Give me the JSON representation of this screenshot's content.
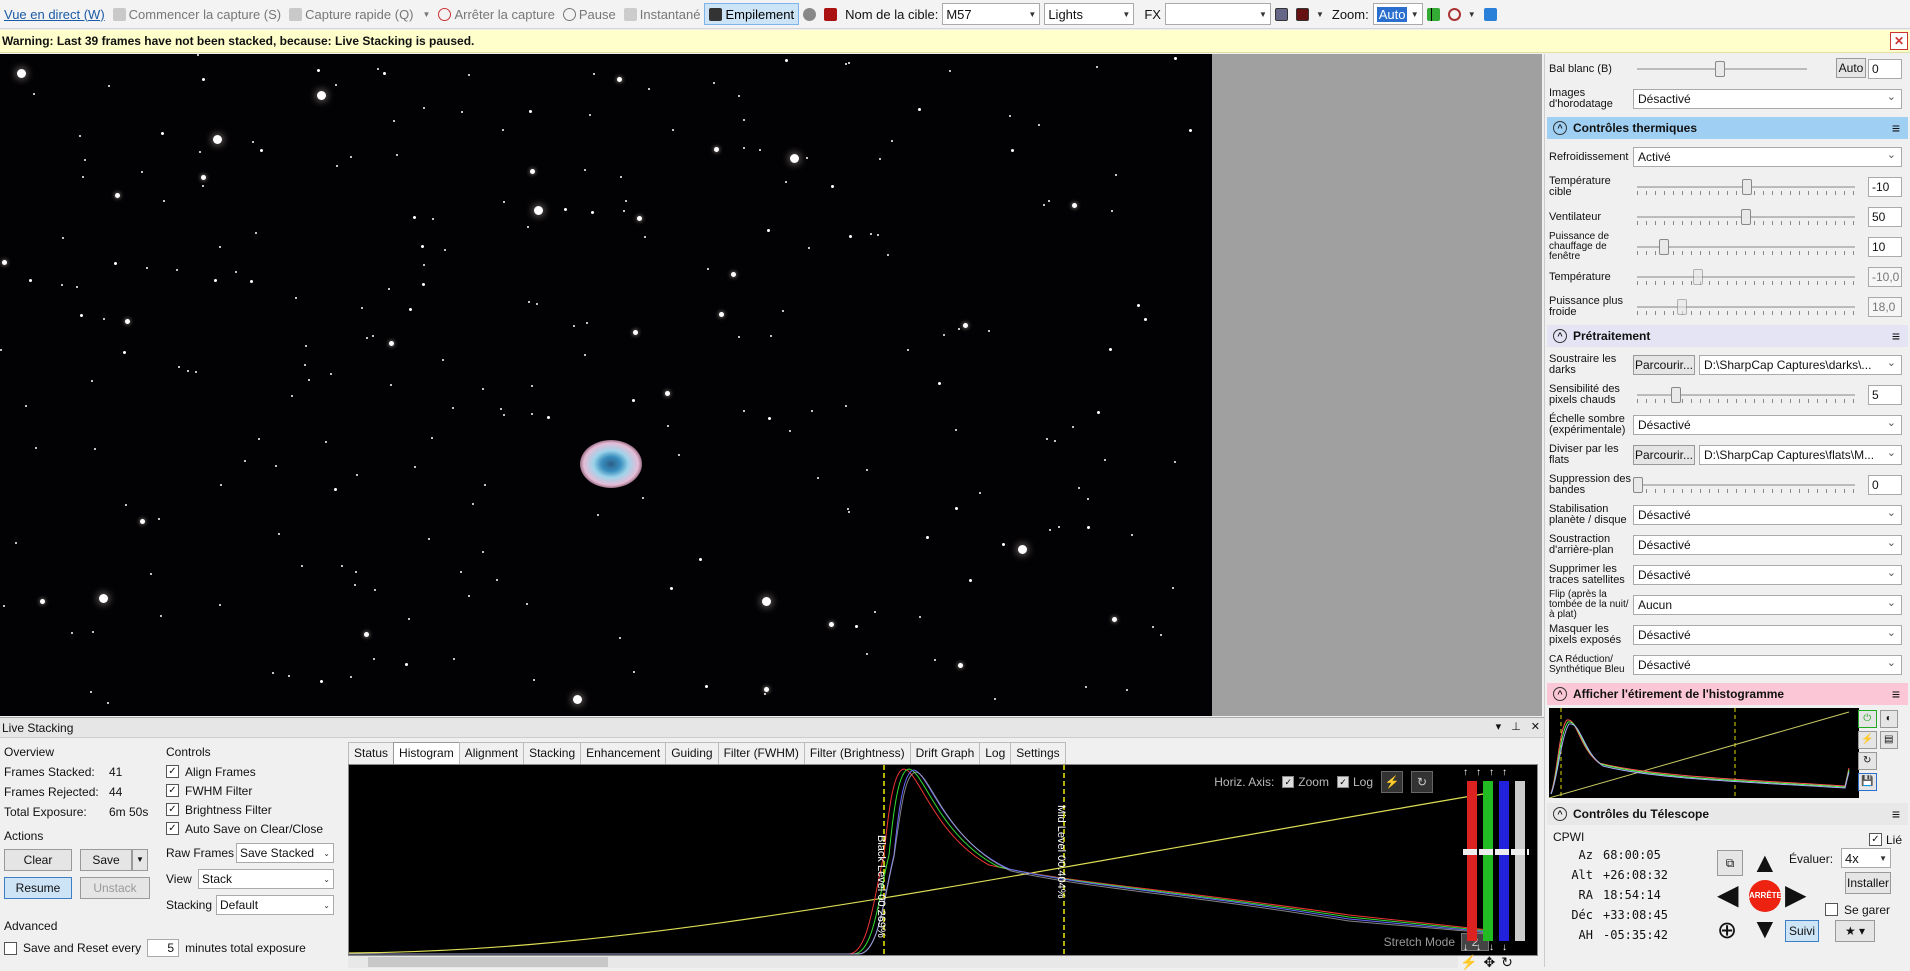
{
  "toolbar": {
    "live_view": "Vue en direct (W)",
    "start_capture": "Commencer la capture (S)",
    "quick_capture": "Capture rapide (Q)",
    "stop_capture": "Arrêter la capture",
    "pause": "Pause",
    "snapshot": "Instantané",
    "stacking": "Empilement",
    "target_name_label": "Nom de la cible:",
    "target_name_value": "M57",
    "frame_type_value": "Lights",
    "fx_label": "FX",
    "fx_value": "",
    "zoom_label": "Zoom:",
    "zoom_value": "Auto"
  },
  "warning": {
    "text": "Warning: Last 39 frames have not been stacked, because: Live Stacking is paused."
  },
  "right_panel": {
    "white_balance_b": {
      "label": "Bal blanc (B)",
      "auto": "Auto",
      "value": "0"
    },
    "timestamp": {
      "label": "Images d'horodatage",
      "value": "Désactivé"
    },
    "thermal_section": "Contrôles thermiques",
    "cooling": {
      "label": "Refroidissement",
      "value": "Activé"
    },
    "target_temp": {
      "label": "Température cible",
      "value": "-10"
    },
    "fan": {
      "label": "Ventilateur",
      "value": "50"
    },
    "window_heater": {
      "label": "Puissance de chauffage de fenêtre",
      "value": "10"
    },
    "temperature": {
      "label": "Température",
      "value": "-10,0"
    },
    "cooler_power": {
      "label": "Puissance plus froide",
      "value": "18,0"
    },
    "preprocessing_section": "Prétraitement",
    "subtract_darks": {
      "label": "Soustraire les darks",
      "browse": "Parcourir...",
      "path": "D:\\SharpCap Captures\\darks\\..."
    },
    "hot_pixel": {
      "label": "Sensibilité des pixels chauds",
      "value": "5"
    },
    "dark_scale": {
      "label": "Échelle sombre (expérimentale)",
      "value": "Désactivé"
    },
    "divide_flats": {
      "label": "Diviser par les flats",
      "browse": "Parcourir...",
      "path": "D:\\SharpCap Captures\\flats\\M..."
    },
    "banding": {
      "label": "Suppression des bandes",
      "value": "0"
    },
    "stabilization": {
      "label": "Stabilisation planète / disque",
      "value": "Désactivé"
    },
    "bg_subtraction": {
      "label": "Soustraction d'arrière-plan",
      "value": "Désactivé"
    },
    "satellite": {
      "label": "Supprimer les traces satellites",
      "value": "Désactivé"
    },
    "flip": {
      "label": "Flip (après la tombée de la nuit/à plat)",
      "value": "Aucun"
    },
    "mask_pixels": {
      "label": "Masquer les pixels exposés",
      "value": "Désactivé"
    },
    "ca_reduction": {
      "label": "CA Réduction/ Synthétique Bleu",
      "value": "Désactivé"
    },
    "histogram_section": "Afficher l'étirement de l'histogramme",
    "telescope_section": "Contrôles du Télescope",
    "telescope": {
      "mount": "CPWI",
      "linked": "Lié",
      "az_label": "Az",
      "az": "68:00:05",
      "alt_label": "Alt",
      "alt": "+26:08:32",
      "ra_label": "RA",
      "ra": "18:54:14",
      "dec_label": "Déc",
      "dec": "+33:08:45",
      "ah_label": "AH",
      "ah": "-05:35:42",
      "rate_label": "Évaluer:",
      "rate_value": "4x",
      "install": "Installer",
      "park": "Se garer",
      "track": "Suivi",
      "stop": "ARRÊTE"
    }
  },
  "live_stacking": {
    "title": "Live Stacking",
    "overview": "Overview",
    "frames_stacked_label": "Frames Stacked:",
    "frames_stacked": "41",
    "frames_rejected_label": "Frames Rejected:",
    "frames_rejected": "44",
    "total_exposure_label": "Total Exposure:",
    "total_exposure": "6m 50s",
    "actions": "Actions",
    "clear": "Clear",
    "save": "Save",
    "resume": "Resume",
    "unstack": "Unstack",
    "advanced": "Advanced",
    "save_reset_label": "Save and Reset every",
    "save_reset_value": "5",
    "save_reset_suffix": "minutes total exposure",
    "controls": "Controls",
    "align_frames": "Align Frames",
    "fwhm_filter": "FWHM Filter",
    "brightness_filter": "Brightness Filter",
    "auto_save": "Auto Save on Clear/Close",
    "raw_frames_label": "Raw Frames",
    "raw_frames_value": "Save Stacked",
    "view_label": "View",
    "view_value": "Stack",
    "stacking_label": "Stacking",
    "stacking_value": "Default",
    "tabs": [
      "Status",
      "Histogram",
      "Alignment",
      "Stacking",
      "Enhancement",
      "Guiding",
      "Filter (FWHM)",
      "Filter (Brightness)",
      "Drift Graph",
      "Log",
      "Settings"
    ],
    "histogram": {
      "horiz_axis": "Horiz. Axis:",
      "zoom": "Zoom",
      "log": "Log",
      "black_level": "Black Level 00.269%",
      "mid_level": "Mid Level 00.404%",
      "stretch_mode": "Stretch Mode",
      "stretch_value": "2"
    }
  },
  "colors": {
    "accent": "#3c7fc4",
    "warning_bg": "#ffffcc",
    "thermal_header": "#9fd0f4",
    "histogram_header": "#fbc6d6"
  }
}
